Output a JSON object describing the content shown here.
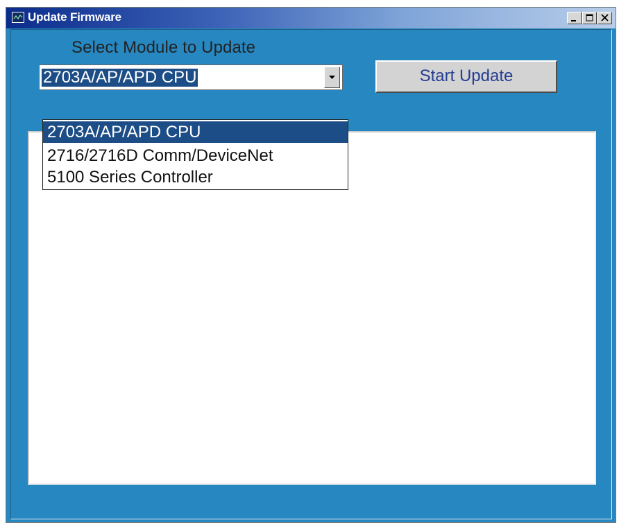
{
  "window": {
    "title": "Update Firmware",
    "controls": {
      "minimize": "minimize-icon",
      "maximize": "maximize-icon",
      "close": "close-icon"
    }
  },
  "form": {
    "select_label": "Select Module to Update",
    "selected_module": "2703A/AP/APD CPU",
    "start_button": "Start Update",
    "module_options": [
      "2703A/AP/APD CPU",
      "2716/2716D Comm/DeviceNet",
      "5100 Series Controller"
    ],
    "output_text": ""
  },
  "colors": {
    "window_bg": "#2787c0",
    "title_bar_start": "#0b2c8c",
    "selection": "#1c4d86",
    "button_text": "#263e93"
  }
}
